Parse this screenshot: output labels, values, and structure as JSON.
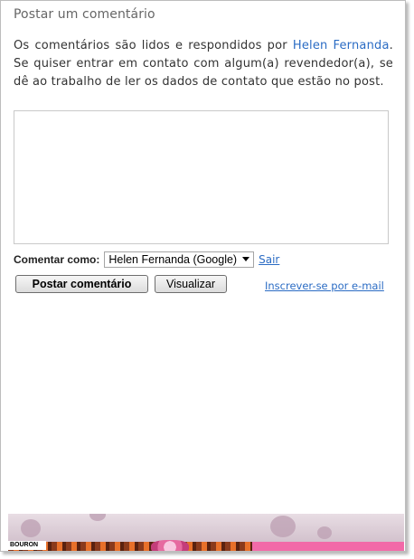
{
  "comments": {
    "title": "Postar um comentário",
    "intro_before": "Os comentários são lidos e respondidos por ",
    "author_link": "Helen Fernanda",
    "intro_after": ". Se quiser entrar em contato com algum(a) revendedor(a), se dê ao trabalho de ler os dados de contato que estão no post.",
    "textarea_value": "",
    "comment_as_label": "Comentar como:",
    "identity_selected": "Helen Fernanda (Google)",
    "signout_link": "Sair",
    "post_button": "Postar comentário",
    "preview_button": "Visualizar",
    "subscribe_link": "Inscrever-se por e-mail"
  },
  "banner": {
    "brand_text": "BOURON"
  },
  "colors": {
    "link": "#2b6cc4",
    "title_text": "#666666",
    "body_text": "#333333"
  }
}
